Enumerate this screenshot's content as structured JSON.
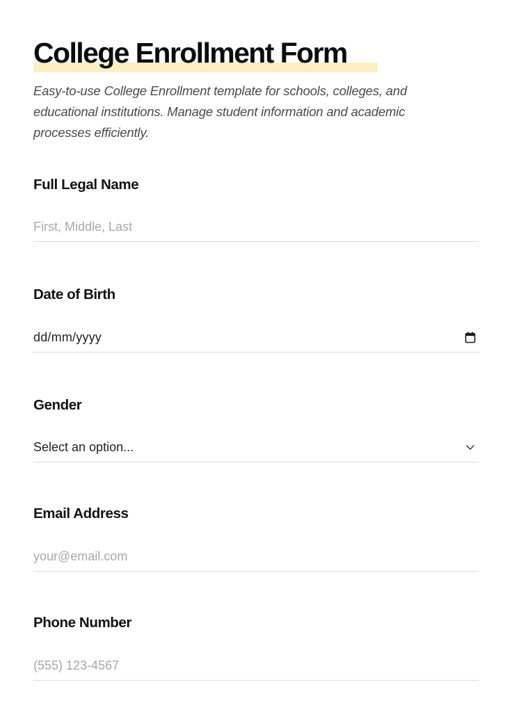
{
  "form": {
    "title": "College Enrollment Form",
    "description": "Easy-to-use College Enrollment template for schools, colleges, and educational institutions. Manage student information and academic processes efficiently.",
    "accent_highlight_color": "#fdefc4"
  },
  "fields": {
    "full_name": {
      "label": "Full Legal Name",
      "placeholder": "First, Middle, Last",
      "value": ""
    },
    "dob": {
      "label": "Date of Birth",
      "value": "dd/mm/yyyy",
      "icon": "calendar-icon"
    },
    "gender": {
      "label": "Gender",
      "selected": "Select an option...",
      "icon": "chevron-down-icon"
    },
    "email": {
      "label": "Email Address",
      "placeholder": "your@email.com",
      "value": ""
    },
    "phone": {
      "label": "Phone Number",
      "placeholder": "(555) 123-4567",
      "value": ""
    }
  }
}
